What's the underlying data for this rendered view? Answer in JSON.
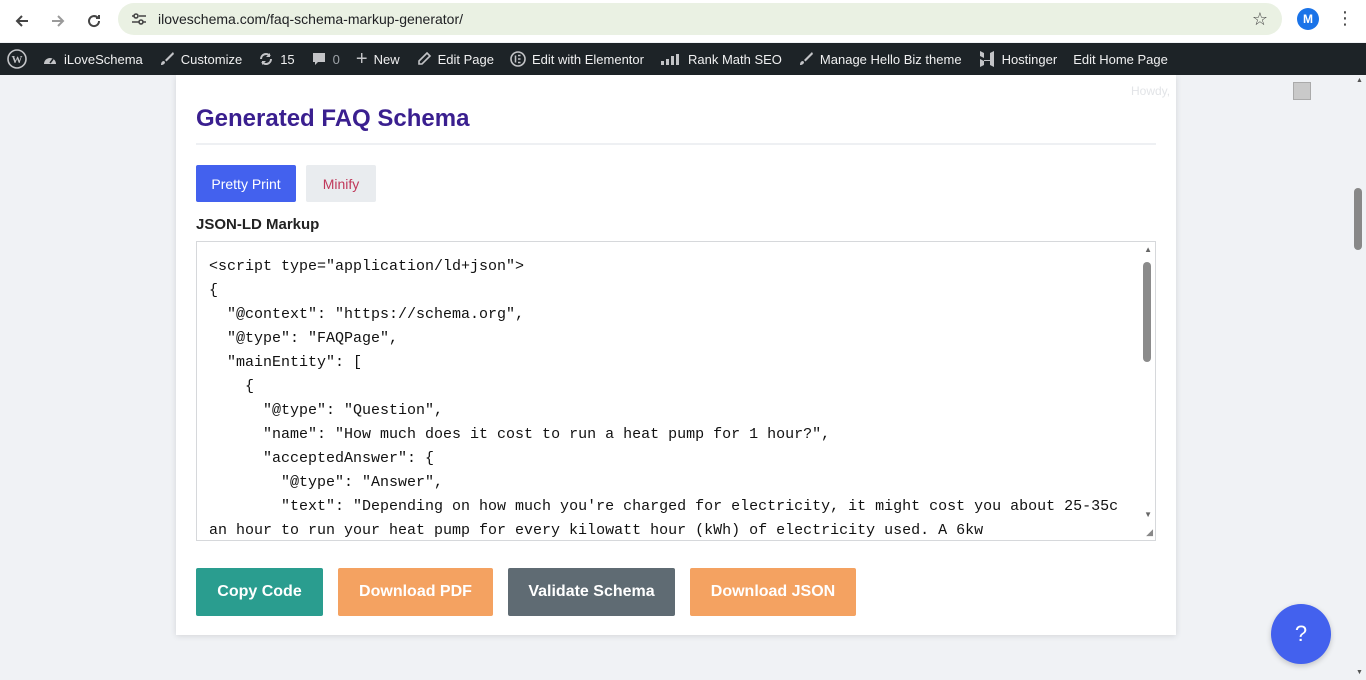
{
  "browser": {
    "url": "iloveschema.com/faq-schema-markup-generator/",
    "profile_initial": "M",
    "icons": [
      "back-arrow-icon",
      "forward-arrow-icon",
      "reload-icon",
      "site-settings-icon",
      "bookmark-star-icon",
      "kebab-menu-icon"
    ]
  },
  "adminbar": {
    "site_name": "iLoveSchema",
    "customize": "Customize",
    "updates": "15",
    "comments": "0",
    "new": "New",
    "edit_page": "Edit Page",
    "elementor": "Edit with Elementor",
    "rank_math": "Rank Math SEO",
    "manage_theme": "Manage Hello Biz theme",
    "hostinger": "Hostinger",
    "edit_home": "Edit Home Page",
    "howdy": "Howdy,"
  },
  "main": {
    "title": "Generated FAQ Schema",
    "pretty_print": "Pretty Print",
    "minify": "Minify",
    "markup_label": "JSON-LD Markup",
    "code": "<script type=\"application/ld+json\">\n{\n  \"@context\": \"https://schema.org\",\n  \"@type\": \"FAQPage\",\n  \"mainEntity\": [\n    {\n      \"@type\": \"Question\",\n      \"name\": \"How much does it cost to run a heat pump for 1 hour?\",\n      \"acceptedAnswer\": {\n        \"@type\": \"Answer\",\n        \"text\": \"Depending on how much you're charged for electricity, it might cost you about 25-35c an hour to run your heat pump for every kilowatt hour (kWh) of electricity used. A 6kw",
    "actions": {
      "copy": "Copy Code",
      "pdf": "Download PDF",
      "validate": "Validate Schema",
      "json": "Download JSON"
    },
    "help": "?"
  },
  "colors": {
    "primary": "#4361ee",
    "teal": "#2a9d8f",
    "orange": "#f4a261",
    "slate": "#5f6b73",
    "title": "#3a1f8f",
    "adminbar": "#1d2327"
  }
}
